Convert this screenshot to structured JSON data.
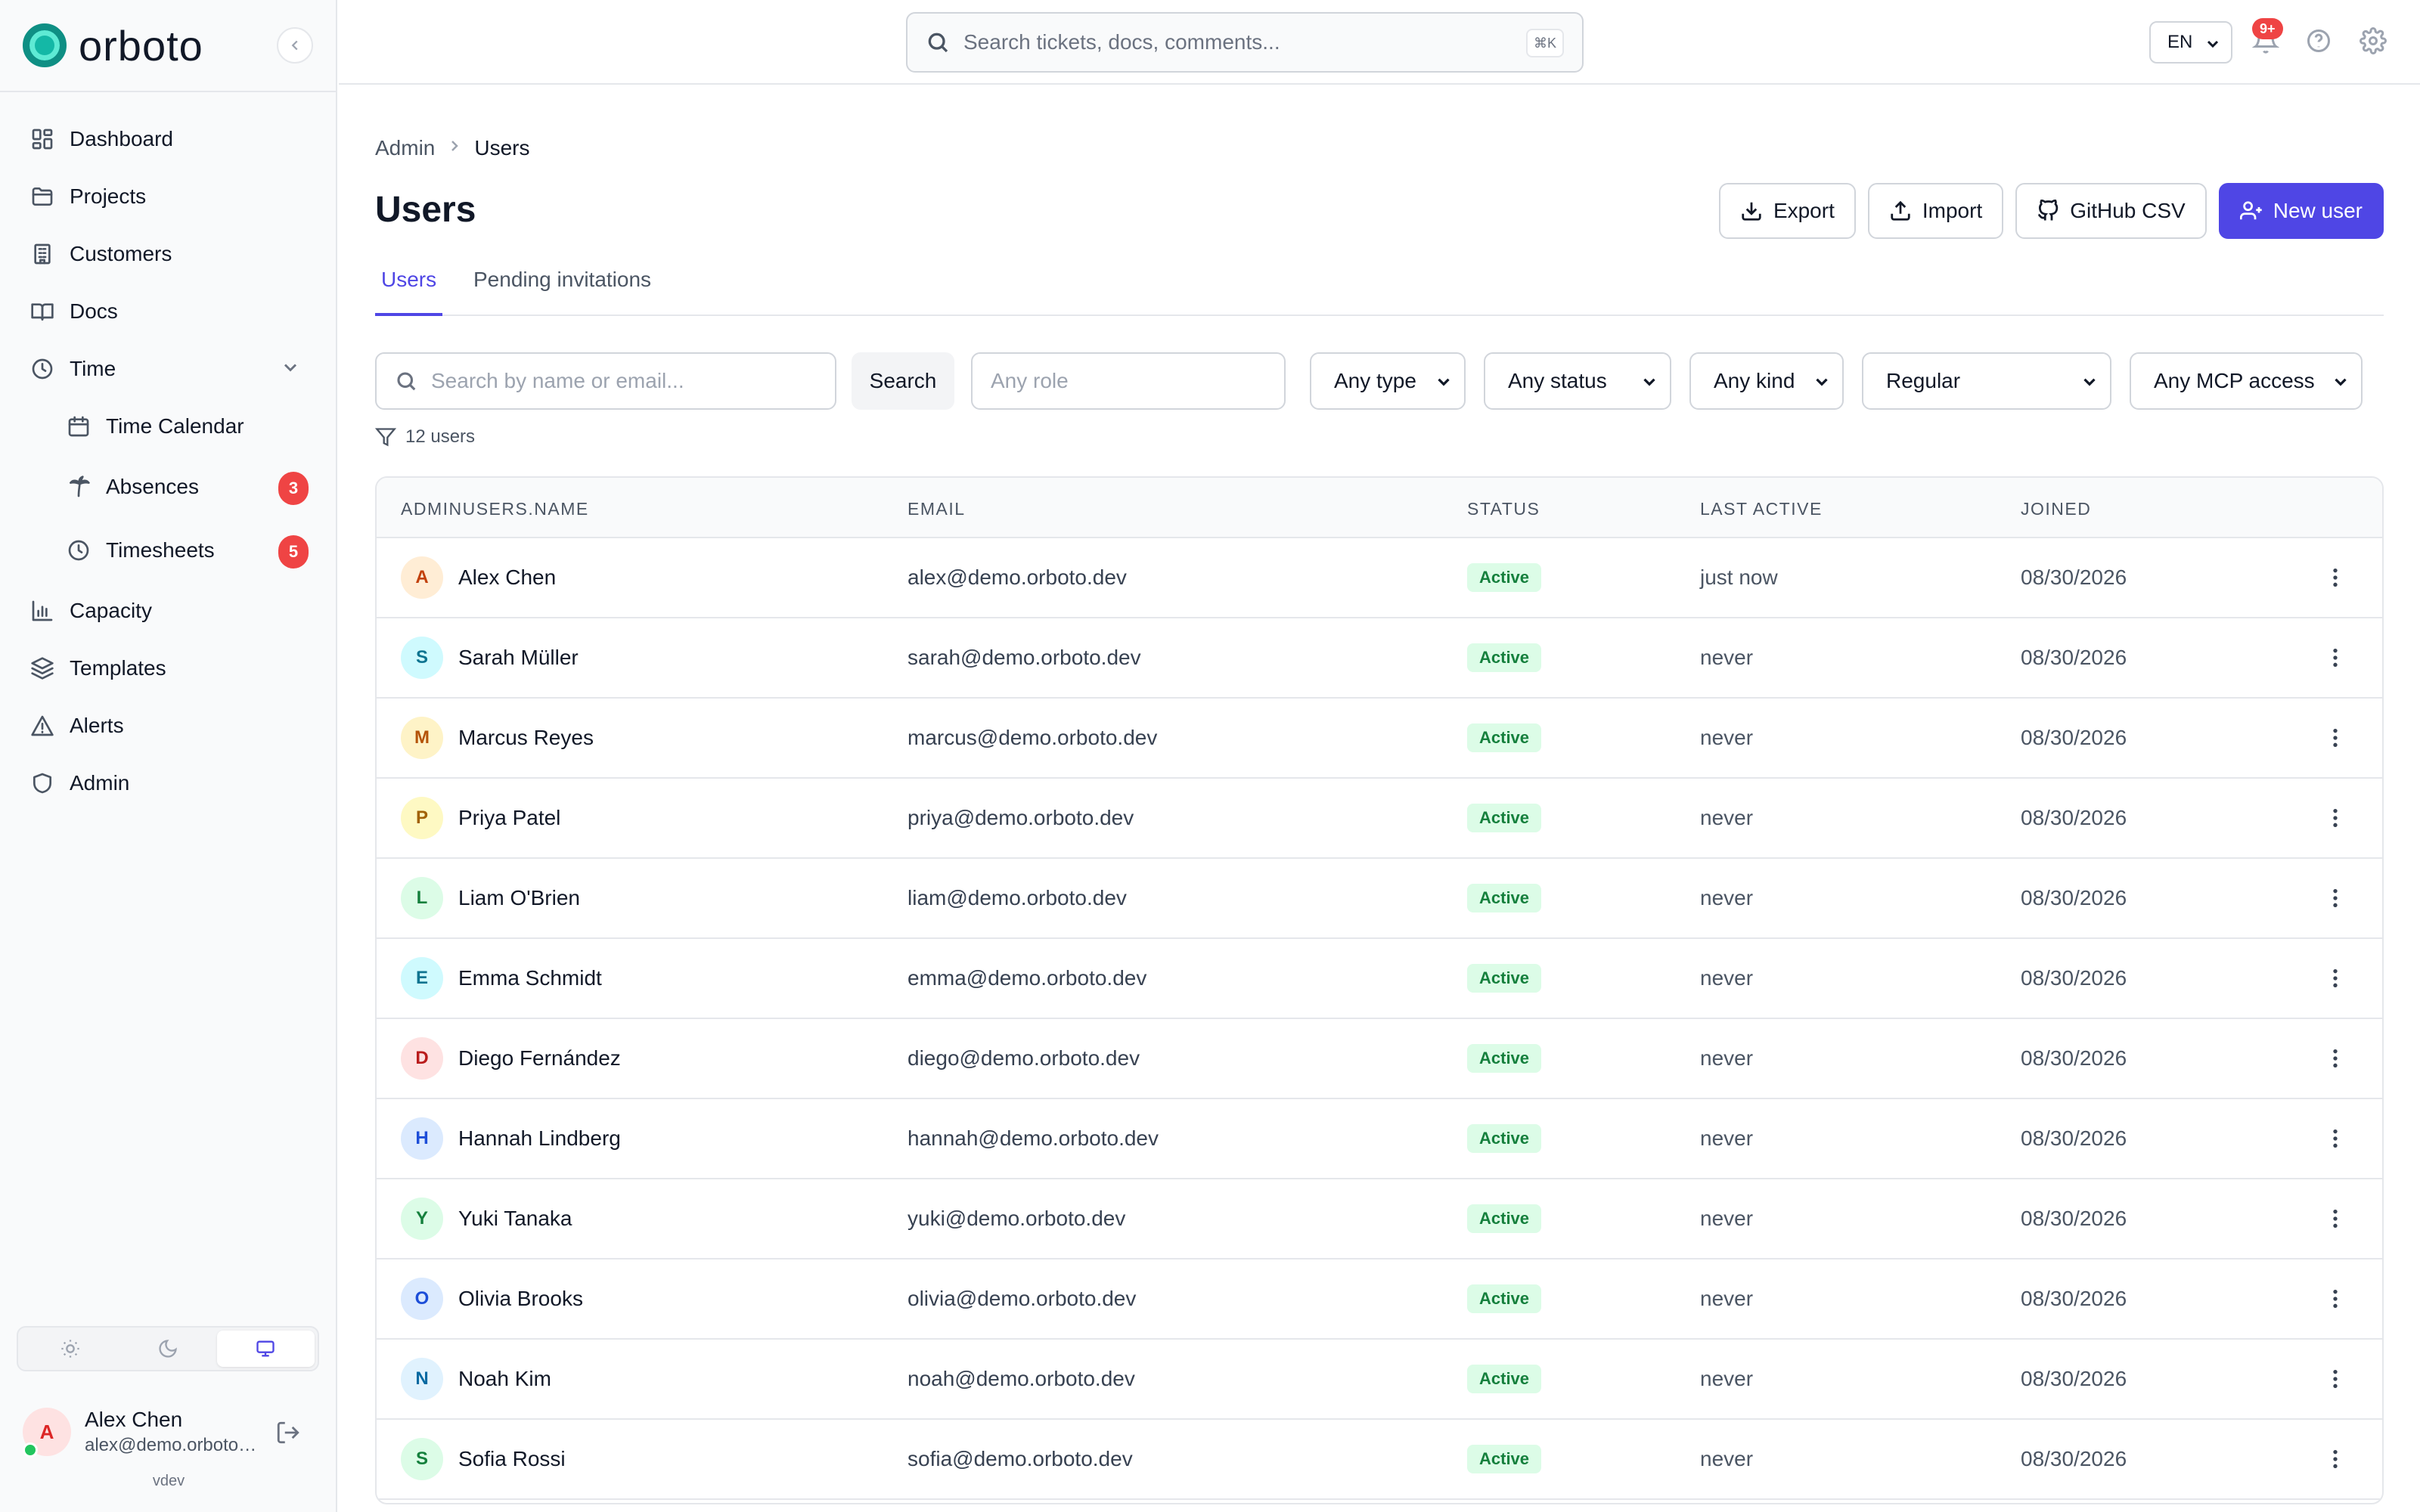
{
  "app": {
    "brand": "orboto",
    "version": "vdev"
  },
  "sidebar": {
    "items": [
      {
        "label": "Dashboard",
        "icon": "dashboard-icon"
      },
      {
        "label": "Projects",
        "icon": "folder-icon"
      },
      {
        "label": "Customers",
        "icon": "building-icon"
      },
      {
        "label": "Docs",
        "icon": "book-icon"
      },
      {
        "label": "Time",
        "icon": "clock-icon"
      },
      {
        "label": "Time Calendar",
        "icon": "calendar-icon"
      },
      {
        "label": "Absences",
        "icon": "palm-tree-icon",
        "badge": "3"
      },
      {
        "label": "Timesheets",
        "icon": "clock-icon",
        "badge": "5"
      },
      {
        "label": "Capacity",
        "icon": "bar-chart-icon"
      },
      {
        "label": "Templates",
        "icon": "layers-icon"
      },
      {
        "label": "Alerts",
        "icon": "warning-icon"
      },
      {
        "label": "Admin",
        "icon": "shield-icon"
      }
    ],
    "user": {
      "initial": "A",
      "name": "Alex Chen",
      "email": "alex@demo.orboto.dev"
    }
  },
  "topbar": {
    "search_placeholder": "Search tickets, docs, comments...",
    "shortcut": "⌘K",
    "language": "EN",
    "notification_count": "9+"
  },
  "breadcrumb": {
    "parent": "Admin",
    "current": "Users"
  },
  "page": {
    "title": "Users",
    "actions": {
      "export": "Export",
      "import": "Import",
      "github_csv": "GitHub CSV",
      "new_user": "New user"
    },
    "tabs": [
      "Users",
      "Pending invitations"
    ]
  },
  "filters": {
    "search_placeholder": "Search by name or email...",
    "search_button": "Search",
    "role_placeholder": "Any role",
    "type": "Any type",
    "status": "Any status",
    "kind": "Any kind",
    "regular": "Regular",
    "mcp_access": "Any MCP access",
    "count_label": "12 users"
  },
  "table": {
    "columns": [
      "ADMINUSERS.NAME",
      "EMAIL",
      "STATUS",
      "LAST ACTIVE",
      "JOINED"
    ],
    "rows": [
      {
        "initial": "A",
        "name": "Alex Chen",
        "email": "alex@demo.orboto.dev",
        "status": "Active",
        "last_active": "just now",
        "joined": "08/30/2026",
        "avatar_bg": "#ffedd5",
        "avatar_fg": "#c2410c"
      },
      {
        "initial": "S",
        "name": "Sarah Müller",
        "email": "sarah@demo.orboto.dev",
        "status": "Active",
        "last_active": "never",
        "joined": "08/30/2026",
        "avatar_bg": "#cffafe",
        "avatar_fg": "#0e7490"
      },
      {
        "initial": "M",
        "name": "Marcus Reyes",
        "email": "marcus@demo.orboto.dev",
        "status": "Active",
        "last_active": "never",
        "joined": "08/30/2026",
        "avatar_bg": "#fef3c7",
        "avatar_fg": "#b45309"
      },
      {
        "initial": "P",
        "name": "Priya Patel",
        "email": "priya@demo.orboto.dev",
        "status": "Active",
        "last_active": "never",
        "joined": "08/30/2026",
        "avatar_bg": "#fef9c3",
        "avatar_fg": "#a16207"
      },
      {
        "initial": "L",
        "name": "Liam O'Brien",
        "email": "liam@demo.orboto.dev",
        "status": "Active",
        "last_active": "never",
        "joined": "08/30/2026",
        "avatar_bg": "#dcfce7",
        "avatar_fg": "#15803d"
      },
      {
        "initial": "E",
        "name": "Emma Schmidt",
        "email": "emma@demo.orboto.dev",
        "status": "Active",
        "last_active": "never",
        "joined": "08/30/2026",
        "avatar_bg": "#cffafe",
        "avatar_fg": "#0e7490"
      },
      {
        "initial": "D",
        "name": "Diego Fernández",
        "email": "diego@demo.orboto.dev",
        "status": "Active",
        "last_active": "never",
        "joined": "08/30/2026",
        "avatar_bg": "#fee2e2",
        "avatar_fg": "#b91c1c"
      },
      {
        "initial": "H",
        "name": "Hannah Lindberg",
        "email": "hannah@demo.orboto.dev",
        "status": "Active",
        "last_active": "never",
        "joined": "08/30/2026",
        "avatar_bg": "#dbeafe",
        "avatar_fg": "#1d4ed8"
      },
      {
        "initial": "Y",
        "name": "Yuki Tanaka",
        "email": "yuki@demo.orboto.dev",
        "status": "Active",
        "last_active": "never",
        "joined": "08/30/2026",
        "avatar_bg": "#dcfce7",
        "avatar_fg": "#15803d"
      },
      {
        "initial": "O",
        "name": "Olivia Brooks",
        "email": "olivia@demo.orboto.dev",
        "status": "Active",
        "last_active": "never",
        "joined": "08/30/2026",
        "avatar_bg": "#dbeafe",
        "avatar_fg": "#1d4ed8"
      },
      {
        "initial": "N",
        "name": "Noah Kim",
        "email": "noah@demo.orboto.dev",
        "status": "Active",
        "last_active": "never",
        "joined": "08/30/2026",
        "avatar_bg": "#e0f2fe",
        "avatar_fg": "#0369a1"
      },
      {
        "initial": "S",
        "name": "Sofia Rossi",
        "email": "sofia@demo.orboto.dev",
        "status": "Active",
        "last_active": "never",
        "joined": "08/30/2026",
        "avatar_bg": "#dcfce7",
        "avatar_fg": "#15803d"
      }
    ]
  }
}
